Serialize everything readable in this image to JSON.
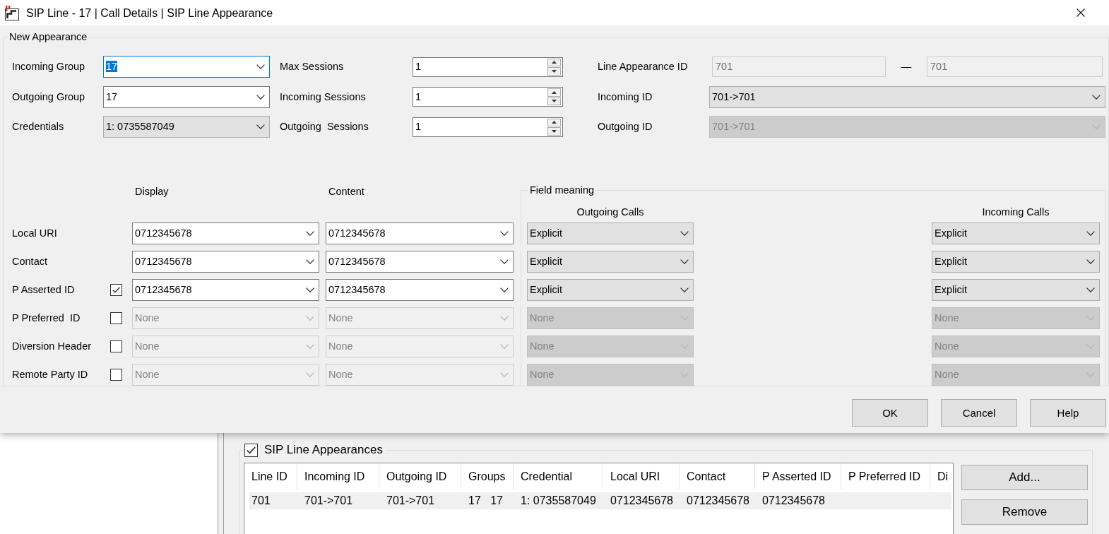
{
  "window": {
    "title": "SIP Line - 17 | Call Details | SIP Line Appearance"
  },
  "new_appearance": {
    "title": "New Appearance",
    "group_fields": [
      {
        "label": "Incoming Group",
        "value": "17",
        "kind": "editable",
        "focused": true,
        "disabled": false
      },
      {
        "label": "Outgoing Group",
        "value": "17",
        "kind": "editable",
        "focused": false,
        "disabled": false
      },
      {
        "label": "Credentials",
        "value": "1: 0735587049",
        "kind": "list",
        "focused": false,
        "disabled": false
      }
    ],
    "session_fields": [
      {
        "label": "Max Sessions",
        "value": "1"
      },
      {
        "label": "Incoming Sessions",
        "value": "1"
      },
      {
        "label": "Outgoing  Sessions",
        "value": "1"
      }
    ],
    "id_fields": [
      {
        "label": "Line Appearance ID",
        "kind": "range",
        "from": "701",
        "separator": "—",
        "to": "701",
        "disabled": true
      },
      {
        "label": "Incoming ID",
        "kind": "list",
        "value": "701->701",
        "disabled": false
      },
      {
        "label": "Outgoing ID",
        "kind": "list",
        "value": "701->701",
        "disabled": true
      }
    ],
    "headers": {
      "display": "Display",
      "content": "Content"
    },
    "field_meaning": {
      "title": "Field meaning",
      "outgoing_header": "Outgoing Calls",
      "incoming_header": "Incoming Calls"
    },
    "rows": [
      {
        "label": "Local URI",
        "kind": "plain",
        "disabled": false,
        "display": "0712345678",
        "content": "0712345678",
        "outgoing": "Explicit",
        "incoming": "Explicit"
      },
      {
        "label": "Contact",
        "kind": "plain",
        "disabled": false,
        "display": "0712345678",
        "content": "0712345678",
        "outgoing": "Explicit",
        "incoming": "Explicit"
      },
      {
        "label": "P Asserted ID",
        "kind": "checkbox",
        "checked": true,
        "disabled": false,
        "display": "0712345678",
        "content": "0712345678",
        "outgoing": "Explicit",
        "incoming": "Explicit"
      },
      {
        "label": "P Preferred  ID",
        "kind": "checkbox",
        "checked": false,
        "disabled": true,
        "display": "None",
        "content": "None",
        "outgoing": "None",
        "incoming": "None"
      },
      {
        "label": "Diversion Header",
        "kind": "checkbox",
        "checked": false,
        "disabled": true,
        "display": "None",
        "content": "None",
        "outgoing": "None",
        "incoming": "None"
      },
      {
        "label": "Remote Party ID",
        "kind": "checkbox",
        "checked": false,
        "disabled": true,
        "display": "None",
        "content": "None",
        "outgoing": "None",
        "incoming": "None"
      }
    ]
  },
  "buttons": [
    "OK",
    "Cancel",
    "Help"
  ],
  "background_window": {
    "appearances": {
      "title": "SIP Line Appearances",
      "checked": true,
      "columns": [
        "Line ID",
        "Incoming ID",
        "Outgoing ID",
        "Groups",
        "Credential",
        "Local URI",
        "Contact",
        "P Asserted ID",
        "P Preferred ID",
        "Di"
      ],
      "rows": [
        {
          "selected": true,
          "cells": [
            "701",
            "701->701",
            "701->701",
            "17   17",
            "1: 0735587049",
            "0712345678",
            "0712345678",
            "0712345678"
          ]
        }
      ],
      "buttons": [
        "Add...",
        "Remove"
      ]
    }
  }
}
